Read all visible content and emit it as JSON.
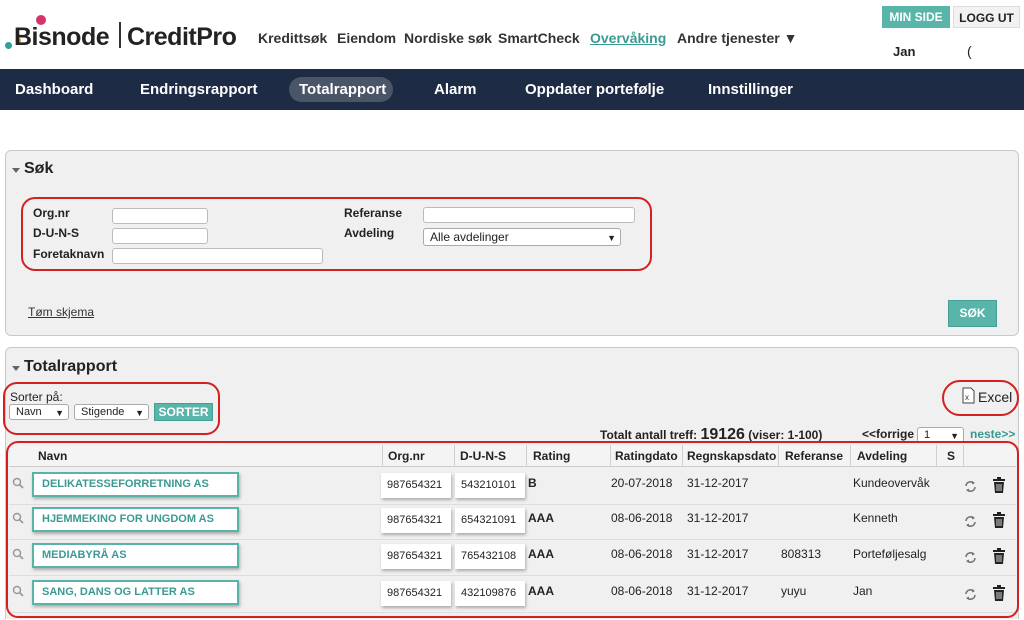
{
  "header": {
    "brand_left": "Bisnode",
    "brand_right": "CreditPro",
    "nav": [
      "Kredittsøk",
      "Eiendom",
      "Nordiske søk",
      "SmartCheck",
      "Overvåking",
      "Andre tjenester ▼"
    ],
    "min_side": "MIN SIDE",
    "logout": "LOGG UT",
    "user": "Jan",
    "paren": "(",
    "paren_close": ")"
  },
  "menu": [
    "Dashboard",
    "Endringsrapport",
    "Totalrapport",
    "Alarm",
    "Oppdater portefølje",
    "Innstillinger"
  ],
  "search": {
    "title": "Søk",
    "orgnr_label": "Org.nr",
    "duns_label": "D-U-N-S",
    "name_label": "Foretaknavn",
    "ref_label": "Referanse",
    "dept_label": "Avdeling",
    "dept_value": "Alle avdelinger",
    "clear_link": "Tøm skjema",
    "search_btn": "SØK"
  },
  "report": {
    "title": "Totalrapport",
    "sort_label": "Sorter på:",
    "sort_field": "Navn",
    "sort_order": "Stigende",
    "sort_btn": "SORTER",
    "excel": "Excel",
    "total_label": "Totalt antall treff:",
    "total_count": "19126",
    "showing": "(viser: 1-100)",
    "prev": "<<forrige",
    "page": "1",
    "next": "neste>>",
    "columns": [
      "Navn",
      "Org.nr",
      "D-U-N-S",
      "Rating",
      "Ratingdato",
      "Regnskapsdato",
      "Referanse",
      "Avdeling",
      "S"
    ],
    "rows": [
      {
        "name": "DELIKATESSEFORRETNING AS",
        "orgnr": "987654321",
        "duns": "543210101",
        "rating": "B",
        "ratingdato": "20-07-2018",
        "regnskapsdato": "31-12-2017",
        "referanse": "",
        "avdeling": "Kundeovervåk"
      },
      {
        "name": "HJEMMEKINO FOR UNGDOM AS",
        "orgnr": "987654321",
        "duns": "654321091",
        "rating": "AAA",
        "ratingdato": "08-06-2018",
        "regnskapsdato": "31-12-2017",
        "referanse": "",
        "avdeling": "Kenneth"
      },
      {
        "name": "MEDIABYRÅ AS",
        "orgnr": "987654321",
        "duns": "765432108",
        "rating": "AAA",
        "ratingdato": "08-06-2018",
        "regnskapsdato": "31-12-2017",
        "referanse": "808313",
        "avdeling": "Porteføljesalg"
      },
      {
        "name": "SANG, DANS OG LATTER AS",
        "orgnr": "987654321",
        "duns": "432109876",
        "rating": "AAA",
        "ratingdato": "08-06-2018",
        "regnskapsdato": "31-12-2017",
        "referanse": "yuyu",
        "avdeling": "Jan"
      }
    ]
  },
  "colors": {
    "teal": "#59b4a9",
    "navy": "#1e2b45",
    "highlight": "#d42020"
  },
  "icons": [
    "search-icon",
    "refresh-icon",
    "trash-icon",
    "excel-file-icon",
    "caret-down-icon"
  ]
}
